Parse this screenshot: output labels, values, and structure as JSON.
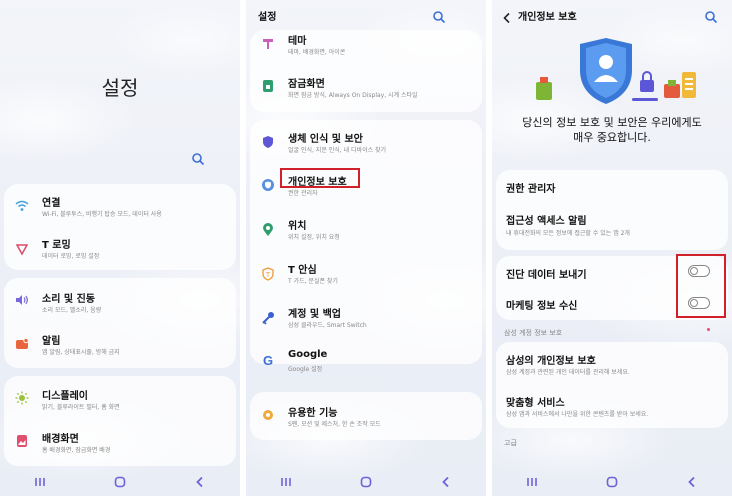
{
  "panel1": {
    "title": "설정",
    "items": [
      {
        "label": "연결",
        "sub": "Wi-Fi, 블루투스, 비행기 탑승 모드, 데이터 사용"
      },
      {
        "label": "T 로밍",
        "sub": "데이터 로밍, 로밍 설정"
      },
      {
        "label": "소리 및 진동",
        "sub": "소리 모드, 벨소리, 음량"
      },
      {
        "label": "알림",
        "sub": "앱 알림, 상태표시줄, 방해 금지"
      },
      {
        "label": "디스플레이",
        "sub": "밝기, 블루라이트 필터, 홈 화면"
      },
      {
        "label": "배경화면",
        "sub": "홈 배경화면, 잠금화면 배경"
      }
    ]
  },
  "panel2": {
    "title": "설정",
    "items": [
      {
        "label": "테마",
        "sub": "테마, 배경화면, 아이콘"
      },
      {
        "label": "잠금화면",
        "sub": "화면 잠금 방식, Always On Display, 시계 스타일"
      },
      {
        "label": "생체 인식 및 보안",
        "sub": "얼굴 인식, 지문 인식, 내 디바이스 찾기"
      },
      {
        "label": "개인정보 보호",
        "sub": "권한 관리자"
      },
      {
        "label": "위치",
        "sub": "위치 설정, 위치 요청"
      },
      {
        "label": "T 안심",
        "sub": "T 가드, 분실폰 찾기"
      },
      {
        "label": "계정 및 백업",
        "sub": "삼성 클라우드, Smart Switch"
      },
      {
        "label": "Google",
        "sub": "Google 설정"
      },
      {
        "label": "유용한 기능",
        "sub": "S펜, 모션 및 제스처, 한 손 조작 모드"
      }
    ]
  },
  "panel3": {
    "title": "개인정보 보호",
    "description_line1": "당신의 정보 보호 및 보안은 우리에게도",
    "description_line2": "매우 중요합니다.",
    "permission_manager": "권한 관리자",
    "accessibility_label": "접근성 액세스 알림",
    "accessibility_sub": "내 휴대전화의 모든 정보에 접근할 수 있는 앱 2개",
    "diagnostic_label": "진단 데이터 보내기",
    "diagnostic_on": false,
    "marketing_label": "마케팅 정보 수신",
    "marketing_on": false,
    "samsung_section": "삼성 계정 정보 보호",
    "samsung_privacy_label": "삼성의 개인정보 보호",
    "samsung_privacy_sub": "삼성 계정과 관련된 개인 데이터를 관리해 보세요.",
    "custom_service_label": "맞춤형 서비스",
    "custom_service_sub": "삼성 앱과 서비스에서 나만을 위한 콘텐츠를 받아 보세요.",
    "advanced_section": "고급"
  },
  "colors": {
    "highlight": "#d0202a",
    "accent_blue": "#3a7bd5"
  }
}
